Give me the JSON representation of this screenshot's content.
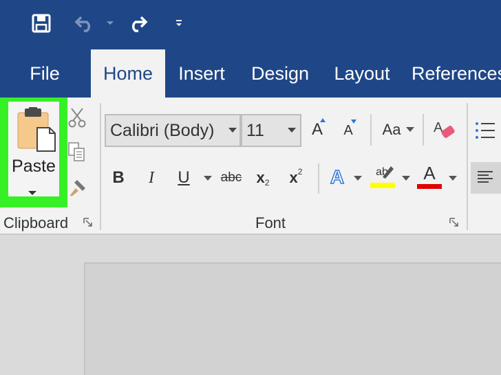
{
  "quick_access": {
    "save": "save-icon",
    "undo": "undo-icon",
    "undo_dropdown": "chevron-down-icon",
    "redo": "redo-icon",
    "customize": "customize-qat-icon"
  },
  "tabs": [
    {
      "label": "File"
    },
    {
      "label": "Home"
    },
    {
      "label": "Insert"
    },
    {
      "label": "Design"
    },
    {
      "label": "Layout"
    },
    {
      "label": "References"
    }
  ],
  "clipboard": {
    "paste_label": "Paste",
    "group_label": "Clipboard"
  },
  "font": {
    "family": "Calibri (Body)",
    "size": "11",
    "change_case_label": "Aa",
    "group_label": "Font",
    "buttons": {
      "bold": "B",
      "italic": "I",
      "underline": "U",
      "strikethrough": "abc",
      "subscript_base": "x",
      "subscript_mark": "2",
      "superscript_base": "x",
      "superscript_mark": "2",
      "grow": "A",
      "shrink": "A",
      "effects": "A",
      "highlight": "ab",
      "font_color": "A"
    }
  },
  "colors": {
    "title_bar": "#1f4787",
    "ribbon": "#f2f2f2",
    "paste_highlight": "#36f026",
    "highlight_yellow": "#ffff00",
    "font_color_red": "#e00000",
    "text_effects_blue": "#2e75d6"
  }
}
